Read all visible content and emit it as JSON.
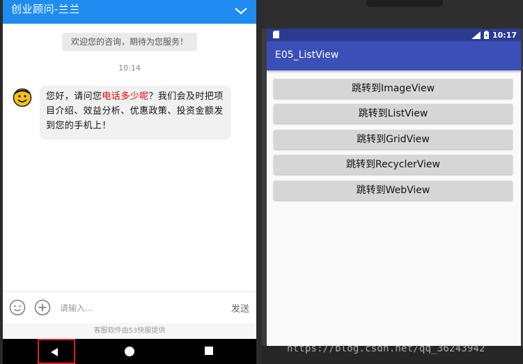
{
  "chat": {
    "title": "创业顾问-兰兰",
    "welcome": "欢迎您的咨询，期待为您服务！",
    "timestamp": "10:14",
    "message": {
      "before": "您好，请问您",
      "highlight": "电话多少呢",
      "after": "？我们会及时把项目介绍、效益分析、优惠政策、投资金额发到您的手机上！",
      "highlight_color": "#e60000"
    },
    "input_placeholder": "请输入...",
    "send_label": "发送",
    "footer": "客服软件由53快服提供",
    "header_color": "#1e8cf0"
  },
  "emulator": {
    "time": "10:17",
    "app_title": "E05_ListView",
    "buttons": [
      "跳转到ImageView",
      "跳转到ListView",
      "跳转到GridView",
      "跳转到RecyclerView",
      "跳转到WebView"
    ],
    "statusbar_color": "#2b3b8f",
    "appbar_color": "#3b4fb8"
  },
  "watermark": "https://blog.csdn.net/qq_36243942",
  "icons": {
    "collapse": "chevron-down-icon",
    "avatar": "smiley-avatar-icon",
    "emoji": "emoji-icon",
    "plus": "plus-icon",
    "back": "back-triangle-icon",
    "home": "home-circle-icon",
    "recent": "recent-square-icon",
    "sd": "sd-card-icon",
    "signal": "signal-icon",
    "battery": "battery-icon"
  }
}
